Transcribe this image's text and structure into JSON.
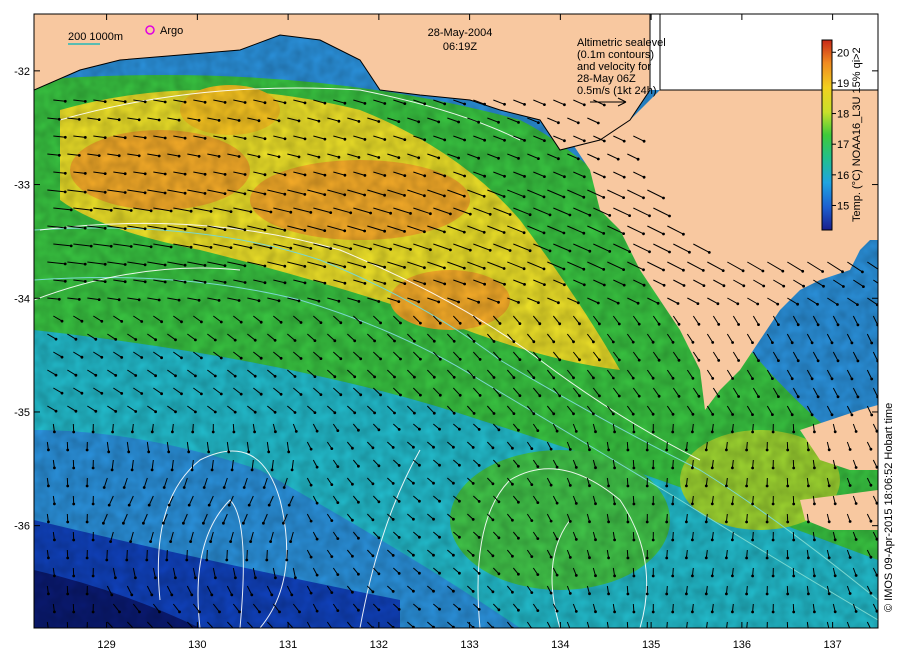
{
  "title": {
    "date": "28-May-2004",
    "time": "06:19Z"
  },
  "legend": {
    "isobaths": "200  1000m",
    "argo": "Argo"
  },
  "altimetry_note": {
    "line1": "Altimetric sealevel",
    "line2": "(0.1m contours)",
    "line3": "and velocity for",
    "line4": "28-May 06Z",
    "line5": "0.5m/s (1kt 24h)"
  },
  "colorbar": {
    "label": "Temp. (°C) NOAA16_L3U 15% qi>2",
    "ticks": [
      "15",
      "16",
      "17",
      "18",
      "19",
      "20"
    ],
    "range": [
      14.2,
      20.4
    ],
    "colors": [
      "#1a1f8c",
      "#1e5fd0",
      "#20a4e0",
      "#22c08a",
      "#3fca3a",
      "#c8e02a",
      "#f2d020",
      "#f08a20",
      "#c82818"
    ]
  },
  "axes": {
    "x_ticks": [
      "129",
      "130",
      "131",
      "132",
      "133",
      "134",
      "135",
      "136",
      "137"
    ],
    "y_ticks": [
      "-32",
      "-33",
      "-34",
      "-35",
      "-36"
    ],
    "x_range": [
      128.2,
      137.5
    ],
    "y_range": [
      -36.9,
      -31.5
    ]
  },
  "credit": "© IMOS 09-Apr-2015 18:06:52 Hobart time",
  "colors": {
    "land": "#f8c8a0",
    "deep_sea": "#0a1a70",
    "contour": "#ffffff",
    "isobath": "#7ad8d0",
    "arrow": "#000000",
    "argo_marker": "#e000e0"
  }
}
